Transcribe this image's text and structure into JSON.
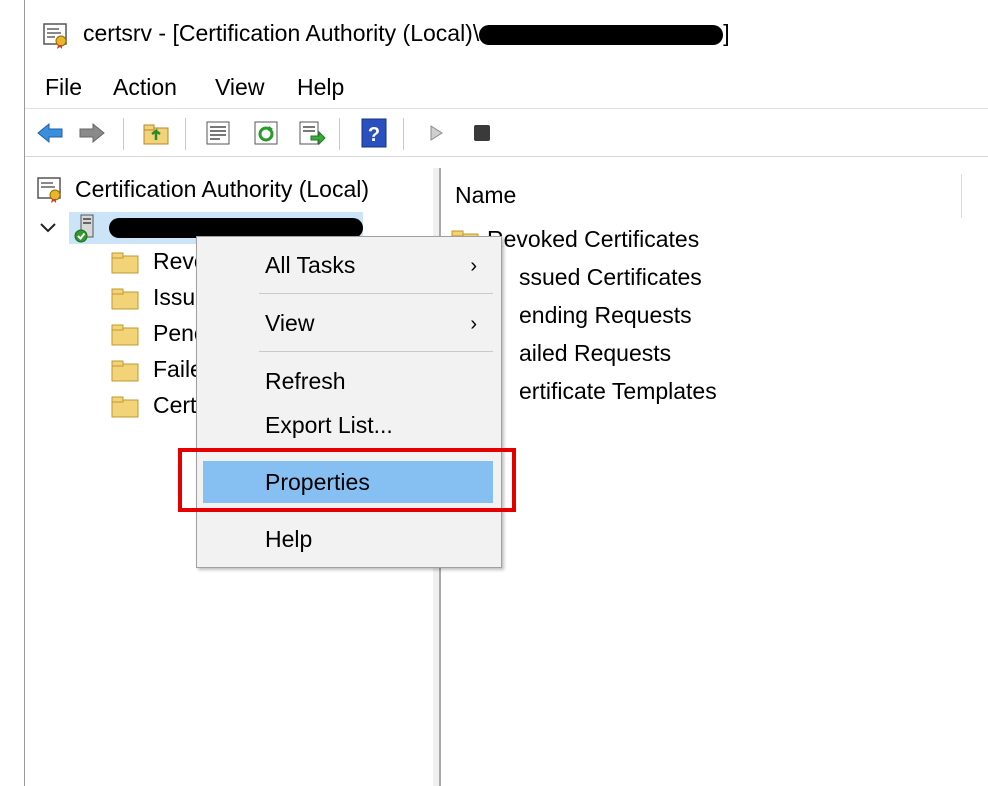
{
  "window": {
    "title_prefix": "certsrv - [Certification Authority (Local)\\",
    "title_suffix": "]",
    "icon": "certsrv-app-icon"
  },
  "menubar": {
    "items": [
      "File",
      "Action",
      "View",
      "Help"
    ]
  },
  "toolbar": {
    "buttons": [
      {
        "name": "back-icon"
      },
      {
        "name": "forward-icon"
      },
      {
        "name": "up-folder-icon"
      },
      {
        "name": "show-hide-console-tree-icon"
      },
      {
        "name": "refresh-icon"
      },
      {
        "name": "export-list-icon"
      },
      {
        "name": "help-icon",
        "label": "?"
      },
      {
        "name": "start-service-icon"
      },
      {
        "name": "stop-service-icon"
      }
    ]
  },
  "tree": {
    "root_label": "Certification Authority (Local)",
    "ca_node_expander": "chevron-down",
    "children": [
      "Revo",
      "Issu",
      "Penc",
      "Faile",
      "Cert"
    ]
  },
  "list": {
    "column_header": "Name",
    "items": [
      "Revoked Certificates",
      "ssued Certificates",
      "ending Requests",
      "ailed Requests",
      "ertificate Templates"
    ]
  },
  "context_menu": {
    "all_tasks": "All Tasks",
    "view": "View",
    "refresh": "Refresh",
    "export_list": "Export List...",
    "properties": "Properties",
    "help": "Help",
    "submenu_arrow": "›"
  },
  "colors": {
    "highlight": "#86bff2",
    "annotation_box": "#e50000",
    "folder": "#f3d378"
  }
}
